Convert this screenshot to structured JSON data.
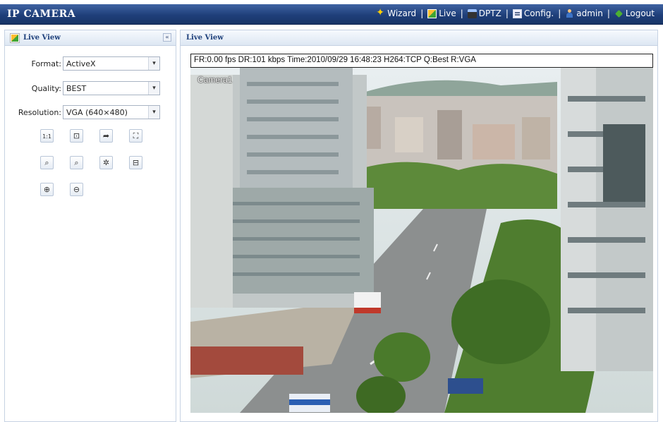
{
  "header": {
    "brand": "IP CAMERA",
    "nav": [
      {
        "label": "Wizard",
        "icon": "wizard-icon"
      },
      {
        "label": "Live",
        "icon": "live-icon"
      },
      {
        "label": "DPTZ",
        "icon": "dptz-icon"
      },
      {
        "label": "Config.",
        "icon": "config-icon"
      },
      {
        "label": "admin",
        "icon": "admin-icon"
      },
      {
        "label": "Logout",
        "icon": "logout-icon"
      }
    ],
    "separator": "|",
    "accent_color": "#1f3f7a"
  },
  "left_panel": {
    "title": "Live View",
    "collapse_symbol": "«",
    "fields": [
      {
        "label": "Format:",
        "value": "ActiveX"
      },
      {
        "label": "Quality:",
        "value": "BEST"
      },
      {
        "label": "Resolution:",
        "value": "VGA (640×480)"
      }
    ],
    "dropdown_arrow": "▾",
    "tools": [
      {
        "name": "original-size-icon",
        "glyph": "1:1"
      },
      {
        "name": "snapshot-folder-icon",
        "glyph": "⊡"
      },
      {
        "name": "forward-arrow-icon",
        "glyph": "➦"
      },
      {
        "name": "fullscreen-icon",
        "glyph": "⛶"
      },
      {
        "name": "zoom-region-icon",
        "glyph": "⌕"
      },
      {
        "name": "zoom-region-2-icon",
        "glyph": "⌕"
      },
      {
        "name": "mask-icon",
        "glyph": "✲"
      },
      {
        "name": "record-icon",
        "glyph": "⊟"
      },
      {
        "name": "zoom-in-icon",
        "glyph": "⊕"
      },
      {
        "name": "zoom-out-icon",
        "glyph": "⊖"
      }
    ]
  },
  "main_panel": {
    "title": "Live View",
    "status": "FR:0.00 fps  DR:101 kbps Time:2010/09/29 16:48:23 H264:TCP Q:Best R:VGA",
    "camera_label": "Camera1"
  }
}
